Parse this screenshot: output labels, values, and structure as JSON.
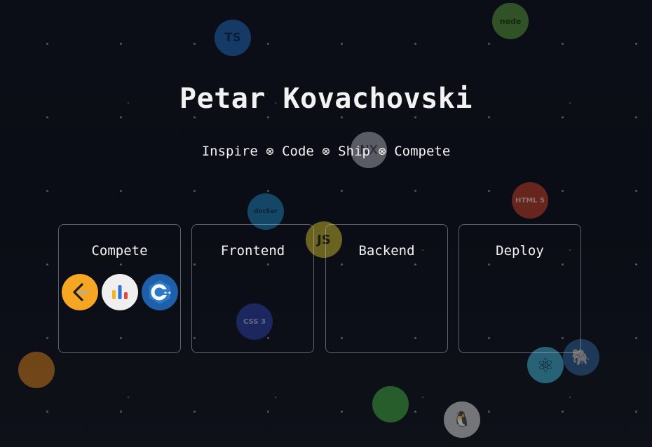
{
  "header": {
    "name": "Petar Kovachovski",
    "tagline": "Inspire ⊗ Code ⊗ Ship ⊗ Compete"
  },
  "cards": [
    {
      "title": "Compete"
    },
    {
      "title": "Frontend"
    },
    {
      "title": "Backend"
    },
    {
      "title": "Deploy"
    }
  ],
  "compete_icons": [
    "leetcode-icon",
    "chart-stats-icon",
    "cpp-icon"
  ],
  "floating_icons": [
    {
      "name": "typescript-icon",
      "label": "TS",
      "color": "#1f5fa8"
    },
    {
      "name": "nodejs-icon",
      "label": "node",
      "color": "#4e8a34"
    },
    {
      "name": "nx-icon",
      "label": "NX",
      "color": "#9a9ca6"
    },
    {
      "name": "docker-icon",
      "label": "docker",
      "color": "#1c78a8"
    },
    {
      "name": "javascript-icon",
      "label": "JS",
      "color": "#b8a92a"
    },
    {
      "name": "html5-icon",
      "label": "HTML 5",
      "color": "#b33b24"
    },
    {
      "name": "css3-icon",
      "label": "CSS 3",
      "color": "#2a3a9a"
    },
    {
      "name": "react-icon",
      "label": "⚛",
      "color": "#3fa5c6"
    },
    {
      "name": "postgresql-icon",
      "label": "🐘",
      "color": "#2d5c8c"
    },
    {
      "name": "linux-icon",
      "label": "🐧",
      "color": "#c8c8c8"
    },
    {
      "name": "spring-icon",
      "label": "",
      "color": "#3a9c3a"
    },
    {
      "name": "grafana-icon",
      "label": "",
      "color": "#c2731c"
    }
  ],
  "colors": {
    "background": "#0c0e17",
    "card_border": "#8f909a",
    "leetcode": "#f5a623",
    "cpp": "#1e5fa8"
  }
}
